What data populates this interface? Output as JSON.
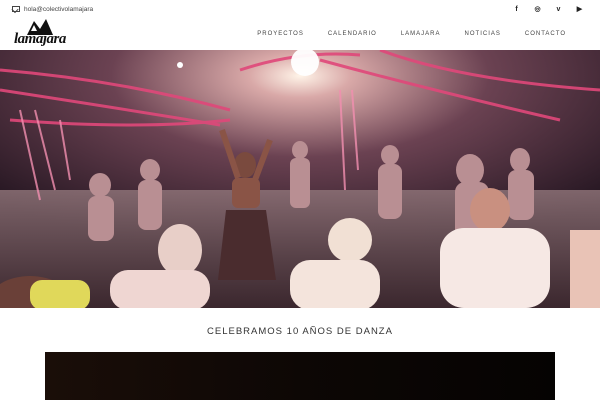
{
  "topbar": {
    "email": "hola@colectivolamajara",
    "social": [
      {
        "name": "facebook",
        "glyph": "f"
      },
      {
        "name": "instagram",
        "glyph": "◎"
      },
      {
        "name": "vimeo",
        "glyph": "v"
      },
      {
        "name": "youtube",
        "glyph": "▶"
      }
    ]
  },
  "header": {
    "logo_text": "lamajara",
    "nav": [
      "PROYECTOS",
      "CALENDARIO",
      "LAMAJARA",
      "NOTICIAS",
      "CONTACTO"
    ]
  },
  "main": {
    "headline": "CELEBRAMOS 10 AÑOS DE DANZA"
  }
}
